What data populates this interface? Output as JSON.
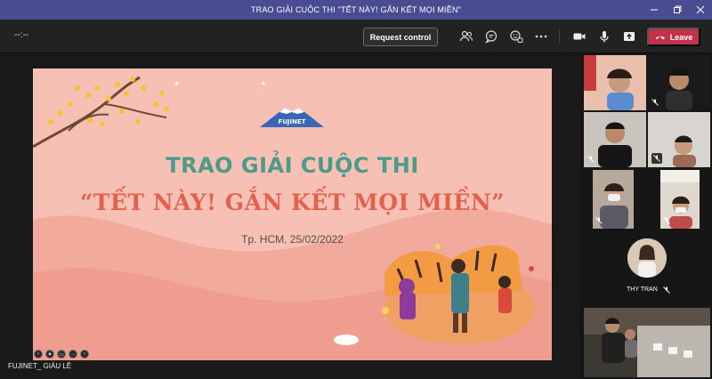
{
  "window": {
    "title": "TRAO GIẢI CUỘC THI \"TẾT NÀY! GẮN KẾT MỌI MIỀN\""
  },
  "toolbar": {
    "timer": "--:--",
    "request_control_label": "Request control",
    "leave_label": "Leave"
  },
  "slide": {
    "logo_text": "FUJINET",
    "heading1": "TRAO GIẢI CUỘC THI",
    "heading2": "“TẾT NÀY! GẮN KẾT MỌI MIỀN”",
    "date": "Tp. HCM, 25/02/2022"
  },
  "presenter": {
    "name": "FUJINET_ GIÀU LÊ"
  },
  "participants": [
    {
      "name": "THY TRAN"
    }
  ],
  "colors": {
    "title_bar": "#4a4c92",
    "leave_red": "#c4314b",
    "slide_bg": "#f6c1b4",
    "heading_teal": "#4e9a8a",
    "heading_red": "#e3604d"
  }
}
